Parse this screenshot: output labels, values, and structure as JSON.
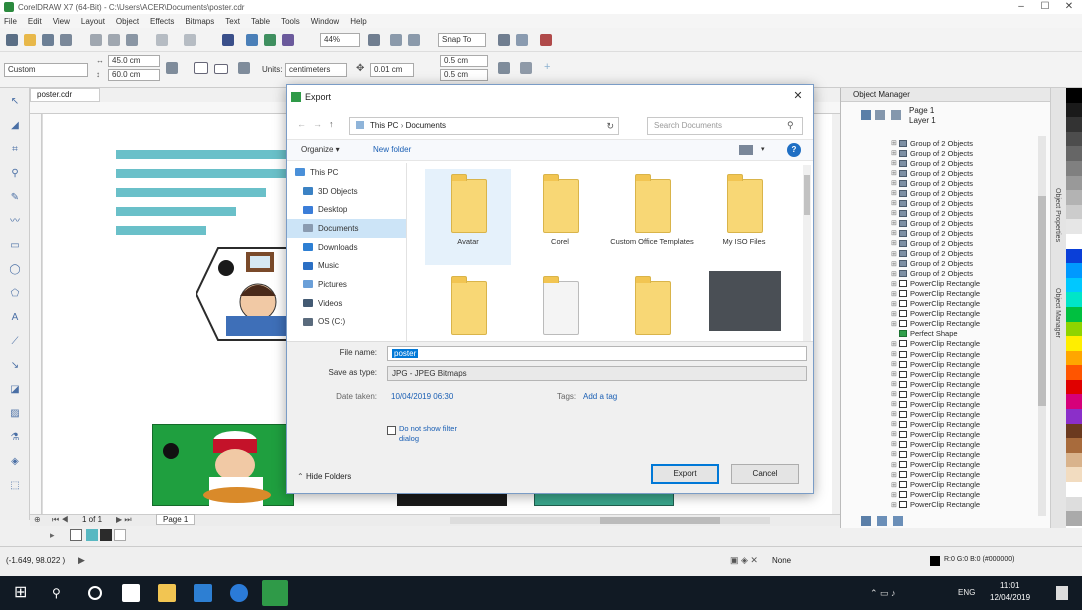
{
  "window": {
    "title": "CorelDRAW X7 (64-Bit) - C:\\Users\\ACER\\Documents\\poster.cdr",
    "controls": [
      "–",
      "☐",
      "✕"
    ]
  },
  "menu": [
    "File",
    "Edit",
    "View",
    "Layout",
    "Object",
    "Effects",
    "Bitmaps",
    "Text",
    "Table",
    "Tools",
    "Window",
    "Help"
  ],
  "toolbar": {
    "zoom": "44%",
    "snap_to": "Snap To",
    "page_preset": "Custom",
    "width": "45.0 cm",
    "height": "60.0 cm",
    "units_label": "Units:",
    "units": "centimeters",
    "nudge": "0.01 cm",
    "dup_x": "0.5 cm",
    "dup_y": "0.5 cm"
  },
  "document": {
    "tab": "poster.cdr",
    "page_counter": "1 of 1",
    "page_tab": "Page 1"
  },
  "dialog": {
    "title": "Export",
    "path": [
      "This PC",
      "Documents"
    ],
    "search_placeholder": "Search Documents",
    "organize": "Organize ▾",
    "new_folder": "New folder",
    "nav_items": [
      {
        "label": "This PC",
        "color": "#4a90d9"
      },
      {
        "label": "3D Objects",
        "color": "#3b82c4"
      },
      {
        "label": "Desktop",
        "color": "#3b7dd8"
      },
      {
        "label": "Documents",
        "color": "#8a9bb0"
      },
      {
        "label": "Downloads",
        "color": "#2d7fd3"
      },
      {
        "label": "Music",
        "color": "#2b6fc4"
      },
      {
        "label": "Pictures",
        "color": "#6a9fd8"
      },
      {
        "label": "Videos",
        "color": "#435a73"
      },
      {
        "label": "OS (C:)",
        "color": "#5a6b7d"
      }
    ],
    "files": [
      {
        "name": "Avatar",
        "selected": true
      },
      {
        "name": "Corel",
        "selected": false
      },
      {
        "name": "Custom Office Templates",
        "selected": false
      },
      {
        "name": "My ISO Files",
        "selected": false
      }
    ],
    "file_name_label": "File name:",
    "file_name": "poster",
    "save_type_label": "Save as type:",
    "save_type": "JPG - JPEG Bitmaps",
    "date_taken_label": "Date taken:",
    "date_taken": "10/04/2019 06:30",
    "tags_label": "Tags:",
    "tags_value": "Add a tag",
    "checkbox_label": "Do not show filter dialog",
    "hide_folders": "Hide Folders",
    "export_button": "Export",
    "cancel_button": "Cancel"
  },
  "object_manager": {
    "title": "Object Manager",
    "page": "Page 1",
    "layer": "Layer 1",
    "items": [
      {
        "label": "Group of 2 Objects",
        "type": "group"
      },
      {
        "label": "Group of 2 Objects",
        "type": "group"
      },
      {
        "label": "Group of 2 Objects",
        "type": "group"
      },
      {
        "label": "Group of 2 Objects",
        "type": "group"
      },
      {
        "label": "Group of 2 Objects",
        "type": "group"
      },
      {
        "label": "Group of 2 Objects",
        "type": "group"
      },
      {
        "label": "Group of 2 Objects",
        "type": "group"
      },
      {
        "label": "Group of 2 Objects",
        "type": "group"
      },
      {
        "label": "Group of 2 Objects",
        "type": "group"
      },
      {
        "label": "Group of 2 Objects",
        "type": "group"
      },
      {
        "label": "Group of 2 Objects",
        "type": "group"
      },
      {
        "label": "Group of 2 Objects",
        "type": "group"
      },
      {
        "label": "Group of 2 Objects",
        "type": "group"
      },
      {
        "label": "Group of 2 Objects",
        "type": "group"
      },
      {
        "label": "PowerClip Rectangle",
        "type": "powerclip"
      },
      {
        "label": "PowerClip Rectangle",
        "type": "powerclip"
      },
      {
        "label": "PowerClip Rectangle",
        "type": "powerclip"
      },
      {
        "label": "PowerClip Rectangle",
        "type": "powerclip"
      },
      {
        "label": "PowerClip Rectangle",
        "type": "powerclip"
      },
      {
        "label": "Perfect Shape",
        "type": "perfect"
      },
      {
        "label": "PowerClip Rectangle",
        "type": "powerclip"
      },
      {
        "label": "PowerClip Rectangle",
        "type": "powerclip"
      },
      {
        "label": "PowerClip Rectangle",
        "type": "powerclip"
      },
      {
        "label": "PowerClip Rectangle",
        "type": "powerclip"
      },
      {
        "label": "PowerClip Rectangle",
        "type": "powerclip"
      },
      {
        "label": "PowerClip Rectangle",
        "type": "powerclip"
      },
      {
        "label": "PowerClip Rectangle",
        "type": "powerclip"
      },
      {
        "label": "PowerClip Rectangle",
        "type": "powerclip"
      },
      {
        "label": "PowerClip Rectangle",
        "type": "powerclip"
      },
      {
        "label": "PowerClip Rectangle",
        "type": "powerclip"
      },
      {
        "label": "PowerClip Rectangle",
        "type": "powerclip"
      },
      {
        "label": "PowerClip Rectangle",
        "type": "powerclip"
      },
      {
        "label": "PowerClip Rectangle",
        "type": "powerclip"
      },
      {
        "label": "PowerClip Rectangle",
        "type": "powerclip"
      },
      {
        "label": "PowerClip Rectangle",
        "type": "powerclip"
      },
      {
        "label": "PowerClip Rectangle",
        "type": "powerclip"
      },
      {
        "label": "PowerClip Rectangle",
        "type": "powerclip"
      }
    ],
    "side_tabs": [
      "Object Properties",
      "Object Manager"
    ]
  },
  "palette": [
    "#000000",
    "#1a1a1a",
    "#333333",
    "#4d4d4d",
    "#666666",
    "#808080",
    "#999999",
    "#b3b3b3",
    "#cccccc",
    "#e6e6e6",
    "#ffffff",
    "#0a3fd8",
    "#0099ff",
    "#00c8ff",
    "#00e5c8",
    "#00c040",
    "#8fd400",
    "#ffee00",
    "#ffa600",
    "#ff5500",
    "#e00000",
    "#d6007a",
    "#8b2fc9",
    "#6b3a1f",
    "#a86b3c",
    "#d9b38c",
    "#f2dcc0",
    "#ffffff",
    "#dddddd",
    "#aaaaaa"
  ],
  "status": {
    "coords": "(-1.649, 98.022 )",
    "fill_label": "None",
    "color_info": "R:0 G:0 B:0 (#000000)"
  },
  "taskbar": {
    "time": "11:01",
    "date": "12/04/2019",
    "lang": "ENG"
  }
}
